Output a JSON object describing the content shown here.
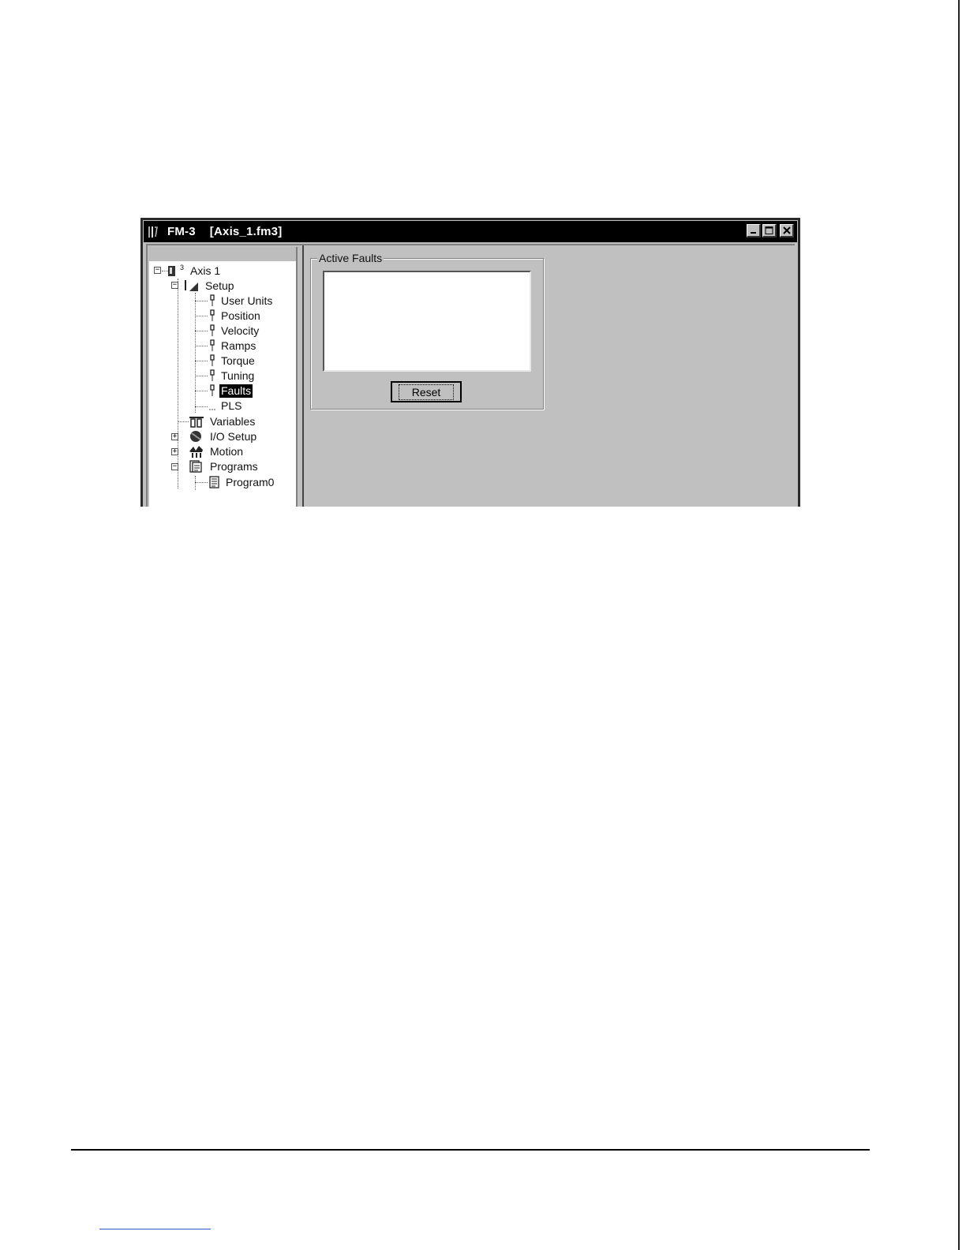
{
  "window": {
    "app_name": "FM-3",
    "document_name": "[Axis_1.fm3]"
  },
  "tree": {
    "root": {
      "label": "Axis 1",
      "badge": "3"
    },
    "items": [
      {
        "label": "Setup",
        "icon": "setup-icon"
      },
      {
        "label": "User Units",
        "icon": "parameter-icon"
      },
      {
        "label": "Position",
        "icon": "parameter-icon"
      },
      {
        "label": "Velocity",
        "icon": "parameter-icon"
      },
      {
        "label": "Ramps",
        "icon": "parameter-icon"
      },
      {
        "label": "Torque",
        "icon": "parameter-icon"
      },
      {
        "label": "Tuning",
        "icon": "parameter-icon"
      },
      {
        "label": "Faults",
        "icon": "parameter-icon",
        "selected": true
      },
      {
        "label": "PLS",
        "icon": "pls-icon"
      },
      {
        "label": "Variables",
        "icon": "variables-icon"
      },
      {
        "label": "I/O Setup",
        "icon": "io-setup-icon"
      },
      {
        "label": "Motion",
        "icon": "motion-icon"
      },
      {
        "label": "Programs",
        "icon": "programs-icon"
      },
      {
        "label": "Program0",
        "icon": "program-document-icon"
      }
    ]
  },
  "faults_panel": {
    "title": "Active Faults",
    "reset_label": "Reset"
  }
}
